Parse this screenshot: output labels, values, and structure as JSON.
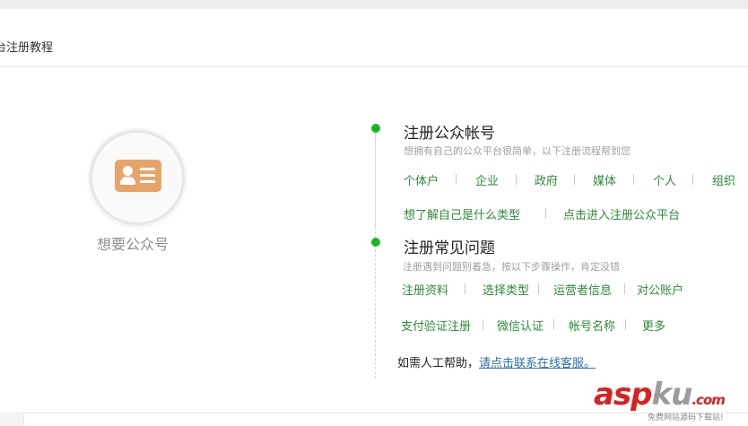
{
  "header": {
    "title": "台注册教程"
  },
  "left_panel": {
    "avatar_icon": "id-card-icon",
    "caption": "想要公众号"
  },
  "section1": {
    "title": "注册公众帐号",
    "description": "想拥有自己的公众平台很简单，以下注册流程帮到您",
    "links_row1": [
      "个体户",
      "企业",
      "政府",
      "媒体",
      "个人",
      "组织"
    ],
    "links_row2": [
      "想了解自己是什么类型",
      "点击进入注册公众平台"
    ]
  },
  "section2": {
    "title": "注册常见问题",
    "description": "注册遇到问题别着急，按以下步骤操作，肯定没错",
    "links_row1": [
      "注册资料",
      "选择类型",
      "运营者信息",
      "对公账户"
    ],
    "links_row2": [
      "支付验证注册",
      "微信认证",
      "帐号名称",
      "更多"
    ]
  },
  "help": {
    "prefix": "如需人工帮助，",
    "link": "请点击联系在线客服。"
  },
  "watermark": {
    "text_asp": "asp",
    "text_ku": "ku",
    "text_com": ".com",
    "subtitle": "免费网站源码下载站!"
  },
  "colors": {
    "accent_green": "#1bb824",
    "link_green": "#2f8a3a",
    "link_blue": "#2e6fa7",
    "icon_orange": "#e8a468"
  }
}
